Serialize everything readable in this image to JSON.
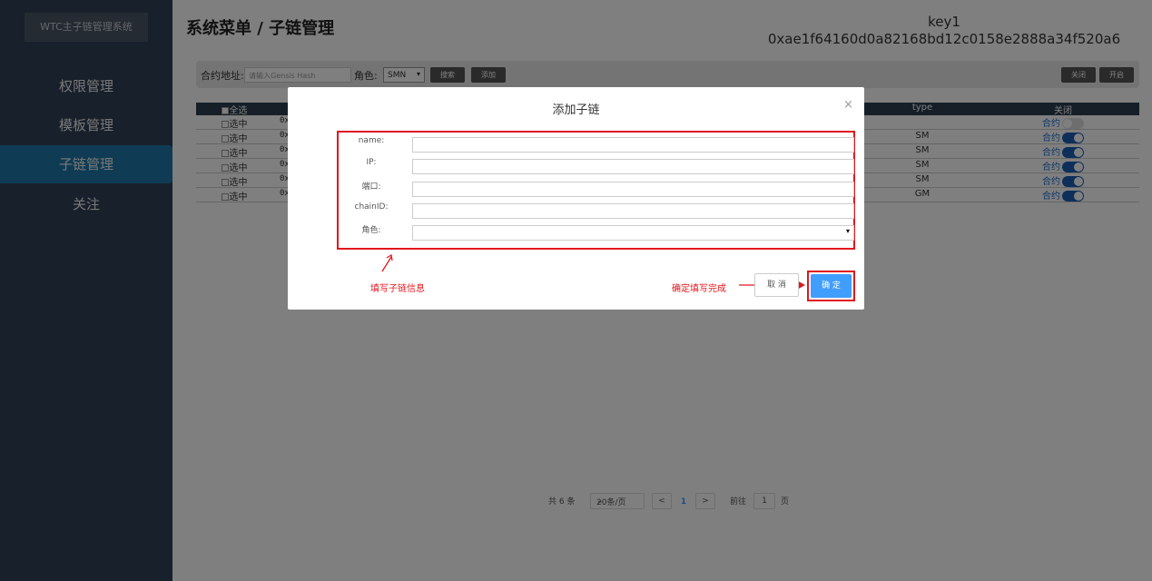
{
  "app": {
    "brand": "WTC主子链管理系统"
  },
  "sidebar": {
    "items": [
      {
        "label": "权限管理",
        "active": false
      },
      {
        "label": "模板管理",
        "active": false
      },
      {
        "label": "子链管理",
        "active": true
      },
      {
        "label": "关注",
        "active": false
      }
    ]
  },
  "header": {
    "title": "系统菜单 / 子链管理",
    "key_name": "key1",
    "key_address": "0xae1f64160d0a82168bd12c0158e2888a34f520a6"
  },
  "toolbar": {
    "address_label": "合约地址:",
    "address_placeholder": "请输入Gensis Hash",
    "role_label": "角色:",
    "role_value": "SMN",
    "search_label": "搜索",
    "add_label": "添加",
    "close_label": "关闭",
    "open_label": "开启"
  },
  "table": {
    "headers": {
      "select_all": "全选",
      "type": "type",
      "switch": "关闭"
    },
    "rows": [
      {
        "select": "选中",
        "address": "0x",
        "type": "",
        "switch_label": "合约",
        "on": false
      },
      {
        "select": "选中",
        "address": "0x",
        "type": "SM",
        "switch_label": "合约",
        "on": true
      },
      {
        "select": "选中",
        "address": "0x",
        "type": "SM",
        "switch_label": "合约",
        "on": true
      },
      {
        "select": "选中",
        "address": "0x",
        "type": "SM",
        "switch_label": "合约",
        "on": true
      },
      {
        "select": "选中",
        "address": "0x",
        "type": "SM",
        "switch_label": "合约",
        "on": true
      },
      {
        "select": "选中",
        "address": "0x",
        "type": "GM",
        "switch_label": "合约",
        "on": true
      }
    ]
  },
  "pager": {
    "total": "共 6 条",
    "page_size": "20条/页",
    "prev": "<",
    "current": "1",
    "next": ">",
    "goto_label": "前往",
    "goto_value": "1",
    "page_suffix": "页"
  },
  "modal": {
    "title": "添加子链",
    "close": "×",
    "fields": {
      "name": "name:",
      "ip": "IP:",
      "port": "端口:",
      "chain_id": "chainID:",
      "role": "角色:"
    },
    "annotation_form": "填写子链信息",
    "annotation_confirm": "确定填写完成",
    "cancel_label": "取 消",
    "ok_label": "确 定"
  },
  "colors": {
    "sidebar": "#304156",
    "active_nav": "#1f79a8",
    "annotation": "#e0171d",
    "primary": "#409eff"
  }
}
